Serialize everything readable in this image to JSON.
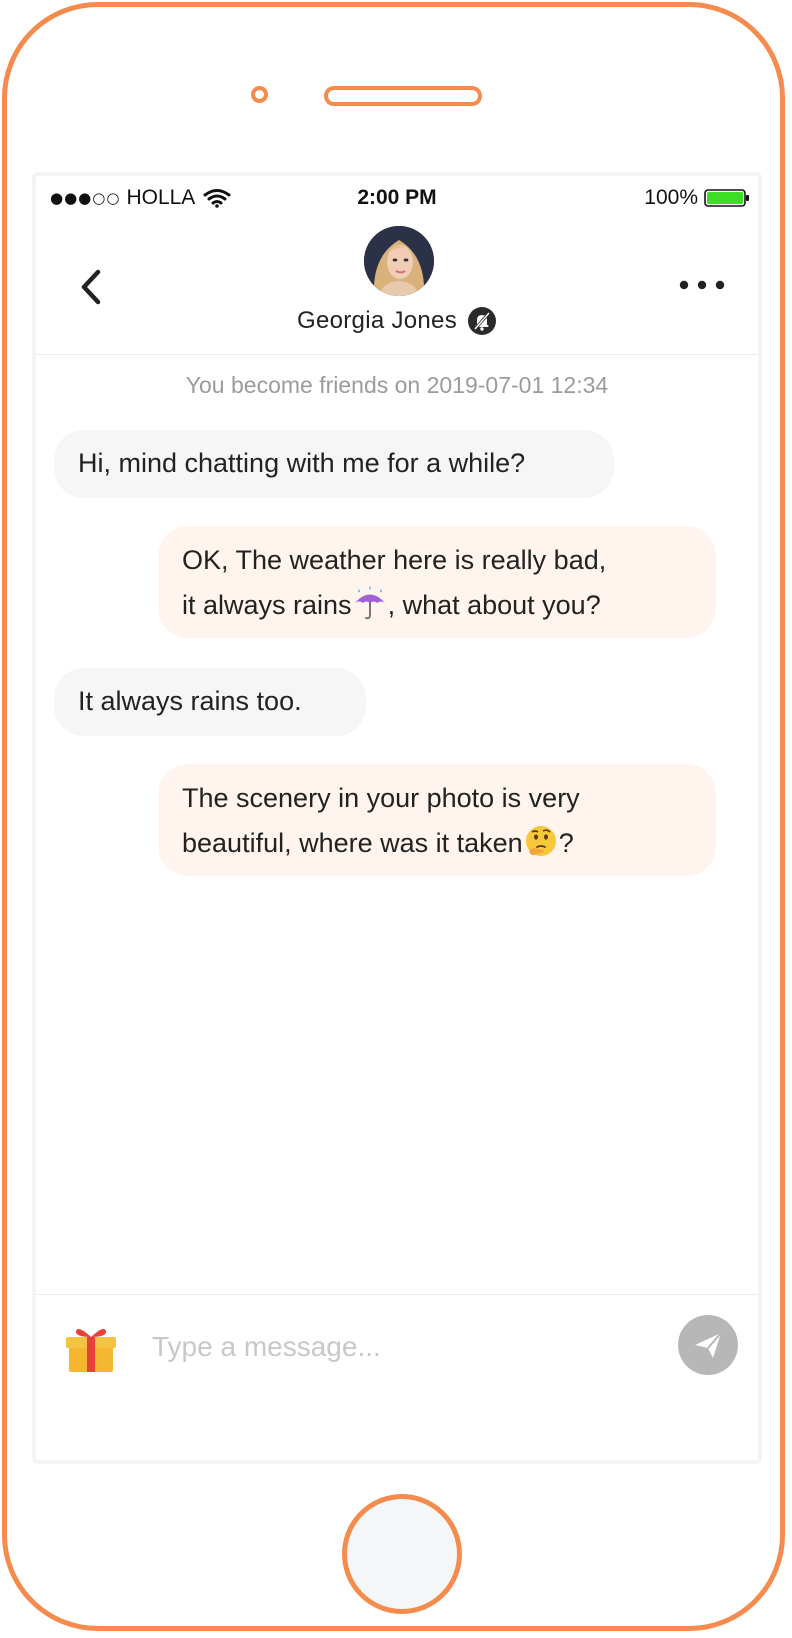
{
  "status_bar": {
    "signal": "●●●○○",
    "carrier": "HOLLA",
    "time": "2:00 PM",
    "battery": "100%",
    "battery_color": "#3ddc25"
  },
  "header": {
    "contact_name": "Georgia Jones",
    "back_icon": "chevron-left-icon",
    "more_icon": "more-dots-icon",
    "mute_icon": "bell-muted-icon"
  },
  "chat": {
    "notice": "You become friends on 2019-07-01 12:34",
    "messages": [
      {
        "direction": "incoming",
        "text": "Hi, mind chatting with me for a while?"
      },
      {
        "direction": "outgoing",
        "line1": "OK, The weather here is really bad,",
        "line2_before": "it always rains",
        "emoji": "☔",
        "line2_after": ", what about you?"
      },
      {
        "direction": "incoming",
        "text": "It always rains too."
      },
      {
        "direction": "outgoing",
        "line1": "The scenery in your photo is very",
        "line2_before": "beautiful, where was it taken",
        "emoji": "🤔",
        "line2_after": "?"
      }
    ]
  },
  "composer": {
    "placeholder": "Type a message...",
    "gift_icon": "gift-icon",
    "send_icon": "paper-plane-icon"
  },
  "colors": {
    "frame": "#f58b4c",
    "incoming_bubble": "#f6f6f6",
    "outgoing_bubble": "#fff4ee",
    "send_button": "#b7b7b7"
  }
}
